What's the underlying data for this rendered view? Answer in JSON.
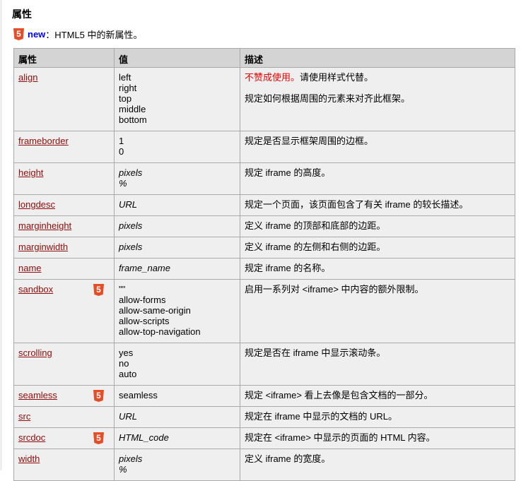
{
  "title": "属性",
  "legend": {
    "icon": "html5-icon",
    "new": "new",
    "text": "：HTML5 中的新属性。"
  },
  "headers": [
    "属性",
    "值",
    "描述"
  ],
  "rows": [
    {
      "attr": "align",
      "html5": false,
      "values": [
        "left",
        "right",
        "top",
        "middle",
        "bottom"
      ],
      "italic": false,
      "deprecated": "不赞成使用。",
      "desc": [
        "请使用样式代替。",
        "规定如何根据周围的元素来对齐此框架。"
      ]
    },
    {
      "attr": "frameborder",
      "html5": false,
      "values": [
        "1",
        "0"
      ],
      "italic": false,
      "desc": [
        "规定是否显示框架周围的边框。"
      ]
    },
    {
      "attr": "height",
      "html5": false,
      "values": [
        "pixels",
        "%"
      ],
      "italic": true,
      "desc": [
        "规定 iframe 的高度。"
      ]
    },
    {
      "attr": "longdesc",
      "html5": false,
      "values": [
        "URL"
      ],
      "italic": true,
      "desc": [
        "规定一个页面，该页面包含了有关 iframe 的较长描述。"
      ]
    },
    {
      "attr": "marginheight",
      "html5": false,
      "values": [
        "pixels"
      ],
      "italic": true,
      "desc": [
        "定义 iframe 的顶部和底部的边距。"
      ]
    },
    {
      "attr": "marginwidth",
      "html5": false,
      "values": [
        "pixels"
      ],
      "italic": true,
      "desc": [
        "定义 iframe 的左侧和右侧的边距。"
      ]
    },
    {
      "attr": "name",
      "html5": false,
      "values": [
        "frame_name"
      ],
      "italic": true,
      "desc": [
        "规定 iframe 的名称。"
      ]
    },
    {
      "attr": "sandbox",
      "html5": true,
      "values": [
        "\"\"",
        "allow-forms",
        "allow-same-origin",
        "allow-scripts",
        "allow-top-navigation"
      ],
      "italic": false,
      "desc": [
        "启用一系列对 <iframe> 中内容的额外限制。"
      ]
    },
    {
      "attr": "scrolling",
      "html5": false,
      "values": [
        "yes",
        "no",
        "auto"
      ],
      "italic": false,
      "desc": [
        "规定是否在 iframe 中显示滚动条。"
      ]
    },
    {
      "attr": "seamless",
      "html5": true,
      "values": [
        "seamless"
      ],
      "italic": false,
      "desc": [
        "规定 <iframe> 看上去像是包含文档的一部分。"
      ]
    },
    {
      "attr": "src",
      "html5": false,
      "values": [
        "URL"
      ],
      "italic": true,
      "desc": [
        "规定在 iframe 中显示的文档的 URL。"
      ]
    },
    {
      "attr": "srcdoc",
      "html5": true,
      "values": [
        "HTML_code"
      ],
      "italic": true,
      "desc": [
        "规定在 <iframe> 中显示的页面的 HTML 内容。"
      ]
    },
    {
      "attr": "width",
      "html5": false,
      "values": [
        "pixels",
        "%"
      ],
      "italic": true,
      "desc": [
        "定义 iframe 的宽度。"
      ]
    }
  ]
}
